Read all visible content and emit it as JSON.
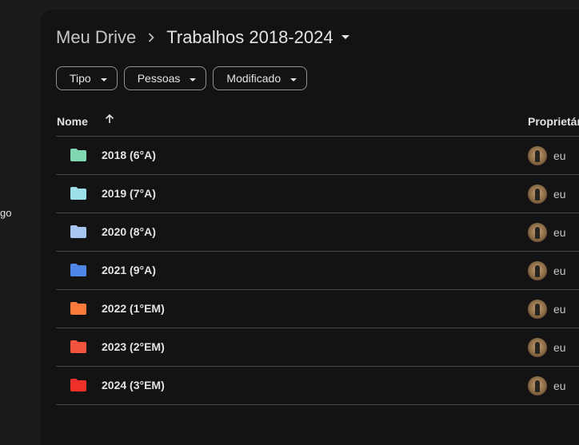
{
  "sidebar": {
    "fragment": "go"
  },
  "breadcrumb": {
    "root": "Meu Drive",
    "current": "Trabalhos 2018-2024"
  },
  "filters": [
    {
      "label": "Tipo"
    },
    {
      "label": "Pessoas"
    },
    {
      "label": "Modificado"
    }
  ],
  "table": {
    "col_name": "Nome",
    "col_owner": "Proprietár",
    "rows": [
      {
        "name": "2018 (6°A)",
        "owner": "eu",
        "color": "#7fd8b1"
      },
      {
        "name": "2019 (7°A)",
        "owner": "eu",
        "color": "#9de0ea"
      },
      {
        "name": "2020 (8°A)",
        "owner": "eu",
        "color": "#a7c6ef"
      },
      {
        "name": "2021 (9°A)",
        "owner": "eu",
        "color": "#4f86e8"
      },
      {
        "name": "2022 (1°EM)",
        "owner": "eu",
        "color": "#fa7a3b"
      },
      {
        "name": "2023 (2°EM)",
        "owner": "eu",
        "color": "#f2543d"
      },
      {
        "name": "2024 (3°EM)",
        "owner": "eu",
        "color": "#ee2f2a"
      }
    ]
  },
  "icons": {
    "breadcrumb_sep": "chevron-right-icon",
    "caret": "arrow-drop-down-icon",
    "sort": "arrow-up-icon",
    "folder": "folder-icon",
    "avatar": "user-avatar"
  }
}
